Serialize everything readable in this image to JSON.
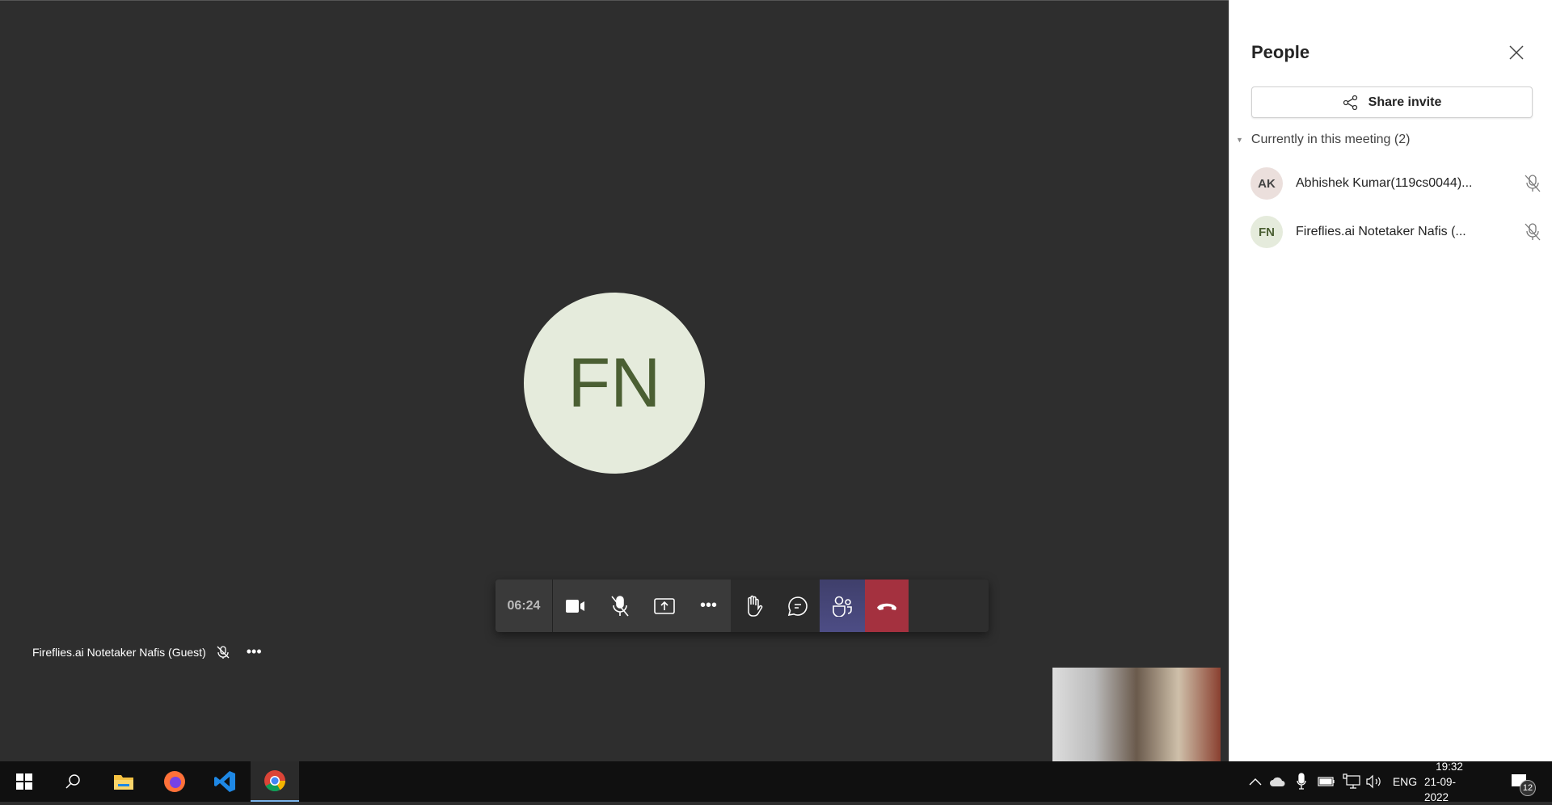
{
  "stage": {
    "avatar_initials": "FN",
    "participant_label": "Fireflies.ai Notetaker Nafis (Guest)"
  },
  "toolbar": {
    "timer": "06:24",
    "icons": [
      "camera-icon",
      "mic-off-icon",
      "share-screen-icon",
      "more-icon",
      "raise-hand-icon",
      "chat-icon",
      "people-icon",
      "hangup-icon"
    ]
  },
  "panel": {
    "title": "People",
    "share_invite": "Share invite",
    "section": "Currently in this meeting (2)",
    "participants": [
      {
        "initials": "AK",
        "name": "Abhishek Kumar(119cs0044)...",
        "avatar_color": "#ebdfdc"
      },
      {
        "initials": "FN",
        "name": "Fireflies.ai Notetaker Nafis (...",
        "avatar_color": "#e5ebdc"
      }
    ]
  },
  "taskbar": {
    "lang": "ENG",
    "time": "19:32",
    "date": "21-09-2022",
    "notifications": "12"
  },
  "colors": {
    "hangup": "#a4313f",
    "people_active": "#464775"
  }
}
